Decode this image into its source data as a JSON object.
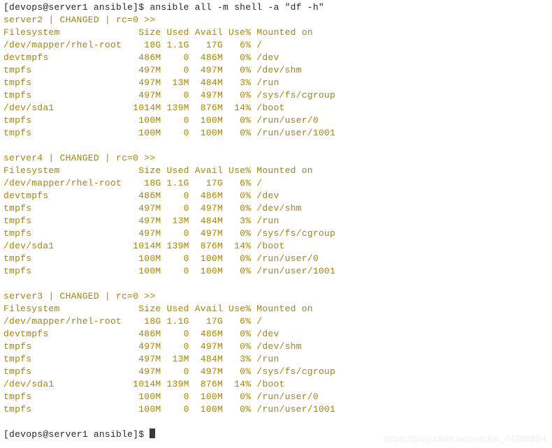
{
  "terminal": {
    "background_color": "#ffffff",
    "prompt_color": "#262626",
    "output_color": "#ab8500",
    "watermark_color": "#f0f0f0",
    "watermark": "https://blog.csdn.net/weixin_44209804",
    "prompt": "[devops@server1 ansible]$",
    "command": "ansible all -m shell -a \"df -h\"",
    "final_prompt": "[devops@server1 ansible]$",
    "cursor": "block"
  },
  "df": {
    "headers": [
      "Filesystem",
      "Size",
      "Used",
      "Avail",
      "Use%",
      "Mounted on"
    ],
    "rows": [
      {
        "filesystem": "/dev/mapper/rhel-root",
        "size": "18G",
        "used": "1.1G",
        "avail": "17G",
        "use_pct": "6%",
        "mounted_on": "/"
      },
      {
        "filesystem": "devtmpfs",
        "size": "486M",
        "used": "0",
        "avail": "486M",
        "use_pct": "0%",
        "mounted_on": "/dev"
      },
      {
        "filesystem": "tmpfs",
        "size": "497M",
        "used": "0",
        "avail": "497M",
        "use_pct": "0%",
        "mounted_on": "/dev/shm"
      },
      {
        "filesystem": "tmpfs",
        "size": "497M",
        "used": "13M",
        "avail": "484M",
        "use_pct": "3%",
        "mounted_on": "/run"
      },
      {
        "filesystem": "tmpfs",
        "size": "497M",
        "used": "0",
        "avail": "497M",
        "use_pct": "0%",
        "mounted_on": "/sys/fs/cgroup"
      },
      {
        "filesystem": "/dev/sda1",
        "size": "1014M",
        "used": "139M",
        "avail": "876M",
        "use_pct": "14%",
        "mounted_on": "/boot"
      },
      {
        "filesystem": "tmpfs",
        "size": "100M",
        "used": "0",
        "avail": "100M",
        "use_pct": "0%",
        "mounted_on": "/run/user/0"
      },
      {
        "filesystem": "tmpfs",
        "size": "100M",
        "used": "0",
        "avail": "100M",
        "use_pct": "0%",
        "mounted_on": "/run/user/1001"
      }
    ]
  },
  "hosts": [
    {
      "name": "server2",
      "status": "CHANGED",
      "rc": "rc=0",
      "suffix": ">>"
    },
    {
      "name": "server4",
      "status": "CHANGED",
      "rc": "rc=0",
      "suffix": ">>"
    },
    {
      "name": "server3",
      "status": "CHANGED",
      "rc": "rc=0",
      "suffix": ">>"
    }
  ],
  "layout": {
    "col_widths": {
      "filesystem": 22,
      "size": 6,
      "used": 5,
      "avail": 6,
      "use_pct": 5
    }
  }
}
